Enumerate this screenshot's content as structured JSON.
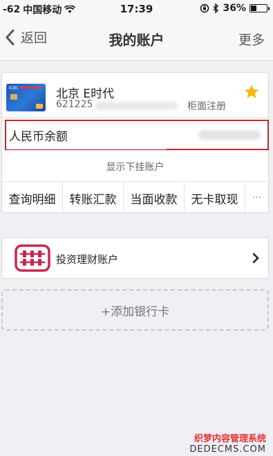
{
  "status": {
    "signal": "-62",
    "carrier": "中国移动",
    "time": "17:39",
    "battery": "36%",
    "battery_level": 0.36
  },
  "nav": {
    "back_label": "返回",
    "title": "我的账户",
    "more_label": "更多"
  },
  "account": {
    "name": "北京 E时代",
    "number_prefix": "621225",
    "reg_type": "柜面注册",
    "balance_label": "人民币余额",
    "show_sub_label": "显示下挂账户",
    "card_text": "ICBC"
  },
  "actions": [
    {
      "label": "查询明细"
    },
    {
      "label": "转账汇款"
    },
    {
      "label": "当面收款"
    },
    {
      "label": "无卡取现"
    },
    {
      "label": "···"
    }
  ],
  "invest": {
    "label": "投资理财账户"
  },
  "add_card": {
    "label": "+添加银行卡"
  },
  "watermark": {
    "line1": "织梦内容管理系统",
    "line2": "DEDECMS.COM"
  },
  "colors": {
    "highlight_border": "#c0262d",
    "star": "#f5b90a",
    "invest_icon": "#c8284a"
  }
}
